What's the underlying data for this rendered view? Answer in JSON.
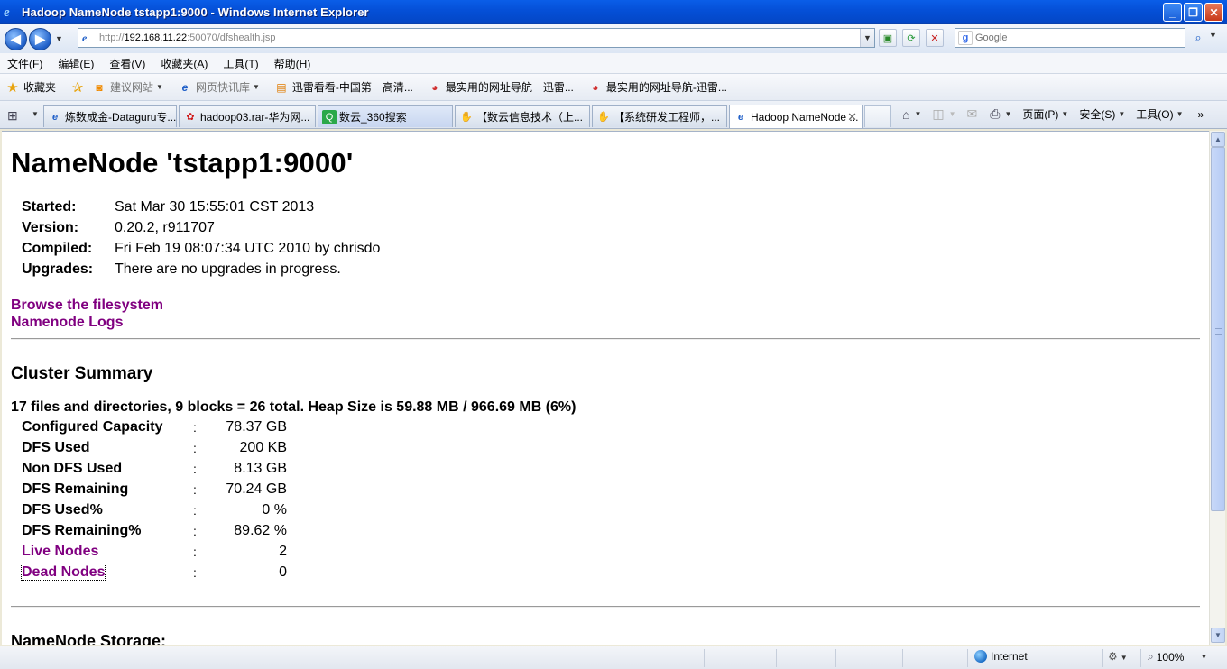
{
  "window": {
    "title": "Hadoop NameNode tstapp1:9000 - Windows Internet Explorer",
    "controls": {
      "minimize": "_",
      "maximize": "❐",
      "close": "✕"
    }
  },
  "address": {
    "url_prefix": "http://",
    "url_host": "192.168.11.22",
    "url_rest": ":50070/dfshealth.jsp"
  },
  "search": {
    "placeholder": "Google"
  },
  "menu": [
    "文件(F)",
    "编辑(E)",
    "查看(V)",
    "收藏夹(A)",
    "工具(T)",
    "帮助(H)"
  ],
  "favorites": {
    "label": "收藏夹",
    "items": [
      {
        "label": "建议网站",
        "icon": "suggested-sites-icon",
        "dropdown": true,
        "muted": true
      },
      {
        "label": "网页快讯库",
        "icon": "web-slice-icon",
        "dropdown": true,
        "muted": true
      },
      {
        "label": "迅雷看看-中国第一高清...",
        "icon": "xunlei-icon",
        "dropdown": false,
        "muted": false
      },
      {
        "label": "最实用的网址导航－迅雷...",
        "icon": "navigation-icon",
        "dropdown": false,
        "muted": false
      },
      {
        "label": "最实用的网址导航-迅雷...",
        "icon": "navigation-icon",
        "dropdown": false,
        "muted": false
      }
    ]
  },
  "tabs": [
    {
      "label": "炼数成金-Dataguru专...",
      "icon": "ie-page-icon",
      "active": false
    },
    {
      "label": "hadoop03.rar-华为网...",
      "icon": "huawei-icon",
      "active": false
    },
    {
      "label": "数云_360搜索",
      "icon": "search-360-icon",
      "active": false
    },
    {
      "label": "【数云信息技术（上...",
      "icon": "hand-icon",
      "active": false
    },
    {
      "label": "【系统研发工程师，...",
      "icon": "hand-icon",
      "active": false
    },
    {
      "label": "Hadoop NameNode ...",
      "icon": "ie-page-icon",
      "active": true
    }
  ],
  "command_bar": {
    "page": "页面(P)",
    "safety": "安全(S)",
    "tools": "工具(O)"
  },
  "page": {
    "title": "NameNode 'tstapp1:9000'",
    "info": [
      {
        "key": "Started:",
        "value": "Sat Mar 30 15:55:01 CST 2013"
      },
      {
        "key": "Version:",
        "value": "0.20.2, r911707"
      },
      {
        "key": "Compiled:",
        "value": "Fri Feb 19 08:07:34 UTC 2010 by chrisdo"
      },
      {
        "key": "Upgrades:",
        "value": "There are no upgrades in progress."
      }
    ],
    "links": [
      "Browse the filesystem",
      "Namenode Logs"
    ],
    "cluster_summary_heading": "Cluster Summary",
    "summary_line": "17 files and directories, 9 blocks = 26 total. Heap Size is 59.88 MB / 966.69 MB (6%)",
    "stats": [
      {
        "key": "Configured Capacity",
        "value": "78.37 GB",
        "link": false
      },
      {
        "key": "DFS Used",
        "value": "200 KB",
        "link": false
      },
      {
        "key": "Non DFS Used",
        "value": "8.13 GB",
        "link": false
      },
      {
        "key": "DFS Remaining",
        "value": "70.24 GB",
        "link": false
      },
      {
        "key": "DFS Used%",
        "value": "0 %",
        "link": false
      },
      {
        "key": "DFS Remaining%",
        "value": "89.62 %",
        "link": false
      },
      {
        "key": "Live Nodes",
        "value": "2",
        "link": true
      },
      {
        "key": "Dead Nodes",
        "value": "0",
        "link": true
      }
    ],
    "stat_separator": ":",
    "storage_heading": "NameNode Storage:"
  },
  "status": {
    "zone": "Internet",
    "zoom": "100%"
  }
}
